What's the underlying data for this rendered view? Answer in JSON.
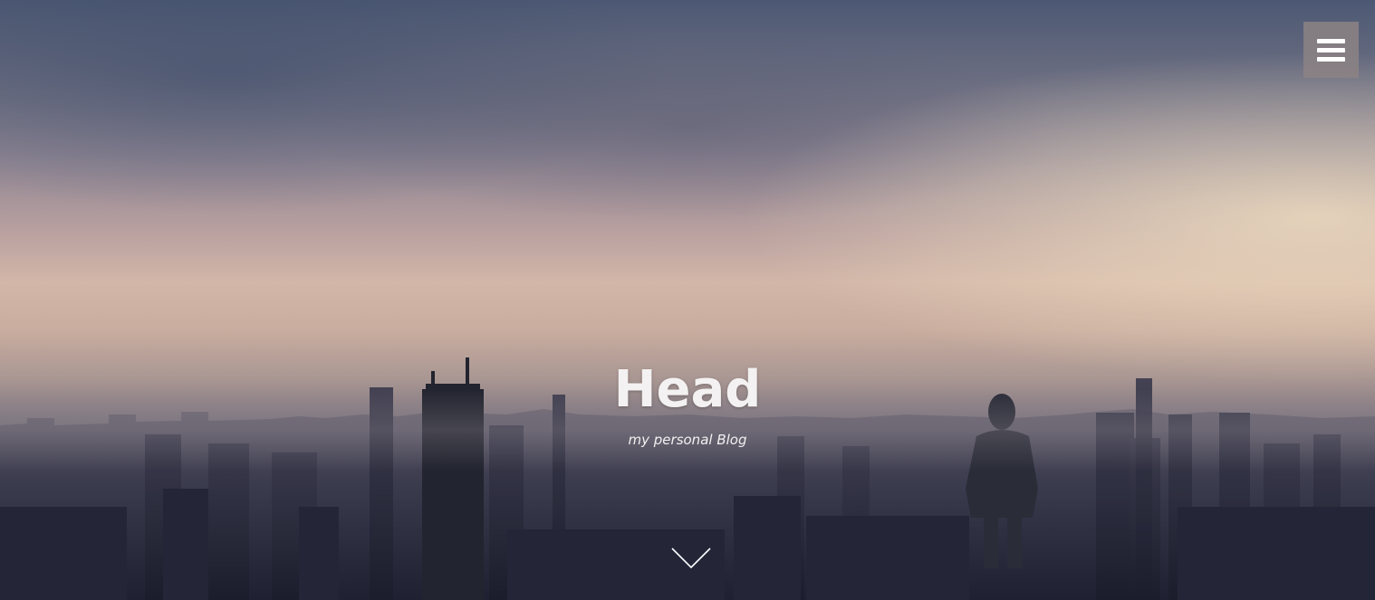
{
  "header": {
    "title": "Head",
    "subtitle": "my personal Blog"
  },
  "menu": {
    "icon": "hamburger-menu-icon"
  },
  "scroll": {
    "icon": "chevron-down-icon"
  },
  "colors": {
    "title_text": "#f3f1f1",
    "menu_bg": "#8c8284",
    "menu_bars": "#ffffff"
  }
}
